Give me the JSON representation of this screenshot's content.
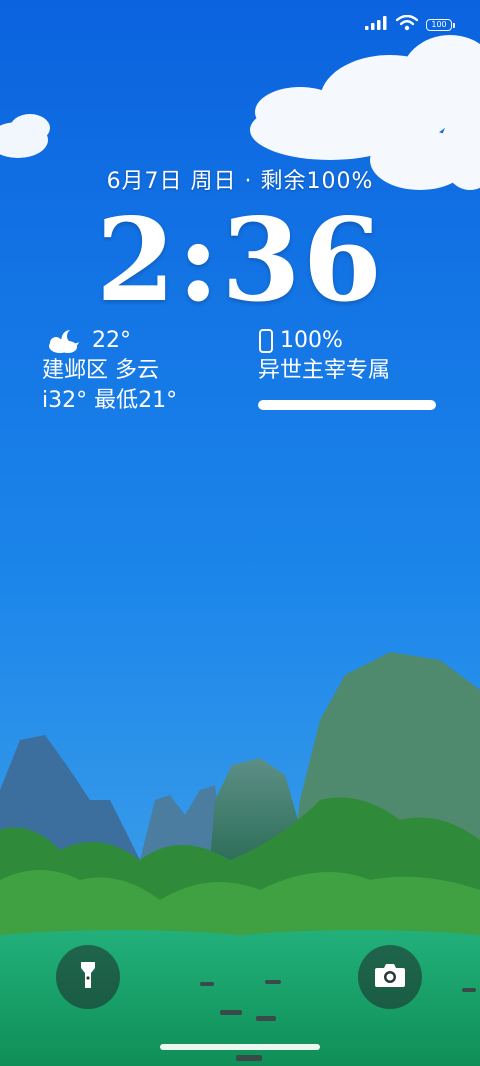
{
  "status_bar": {
    "battery_level": "100",
    "icons": [
      "signal-icon",
      "wifi-icon",
      "battery-icon"
    ]
  },
  "lock_screen": {
    "date_line": "6月7日 周日 · 剩余100%",
    "time": "2:36"
  },
  "weather_widget": {
    "icon": "partly-cloudy-night-icon",
    "temperature": "22°",
    "location_condition": "建邺区 多云",
    "high_low": "i32° 最低21°"
  },
  "device_widget": {
    "icon": "phone-icon",
    "battery_percent": "100%",
    "device_name": "异世主宰专属",
    "battery_fraction": 1.0
  },
  "quick_actions": {
    "left": "flashlight-icon",
    "right": "camera-icon"
  },
  "colors": {
    "sky_top": "#0f68e2",
    "sky_bottom": "#3a9be6",
    "water": "#1aa36a",
    "mountain": "#3f7f8a"
  }
}
